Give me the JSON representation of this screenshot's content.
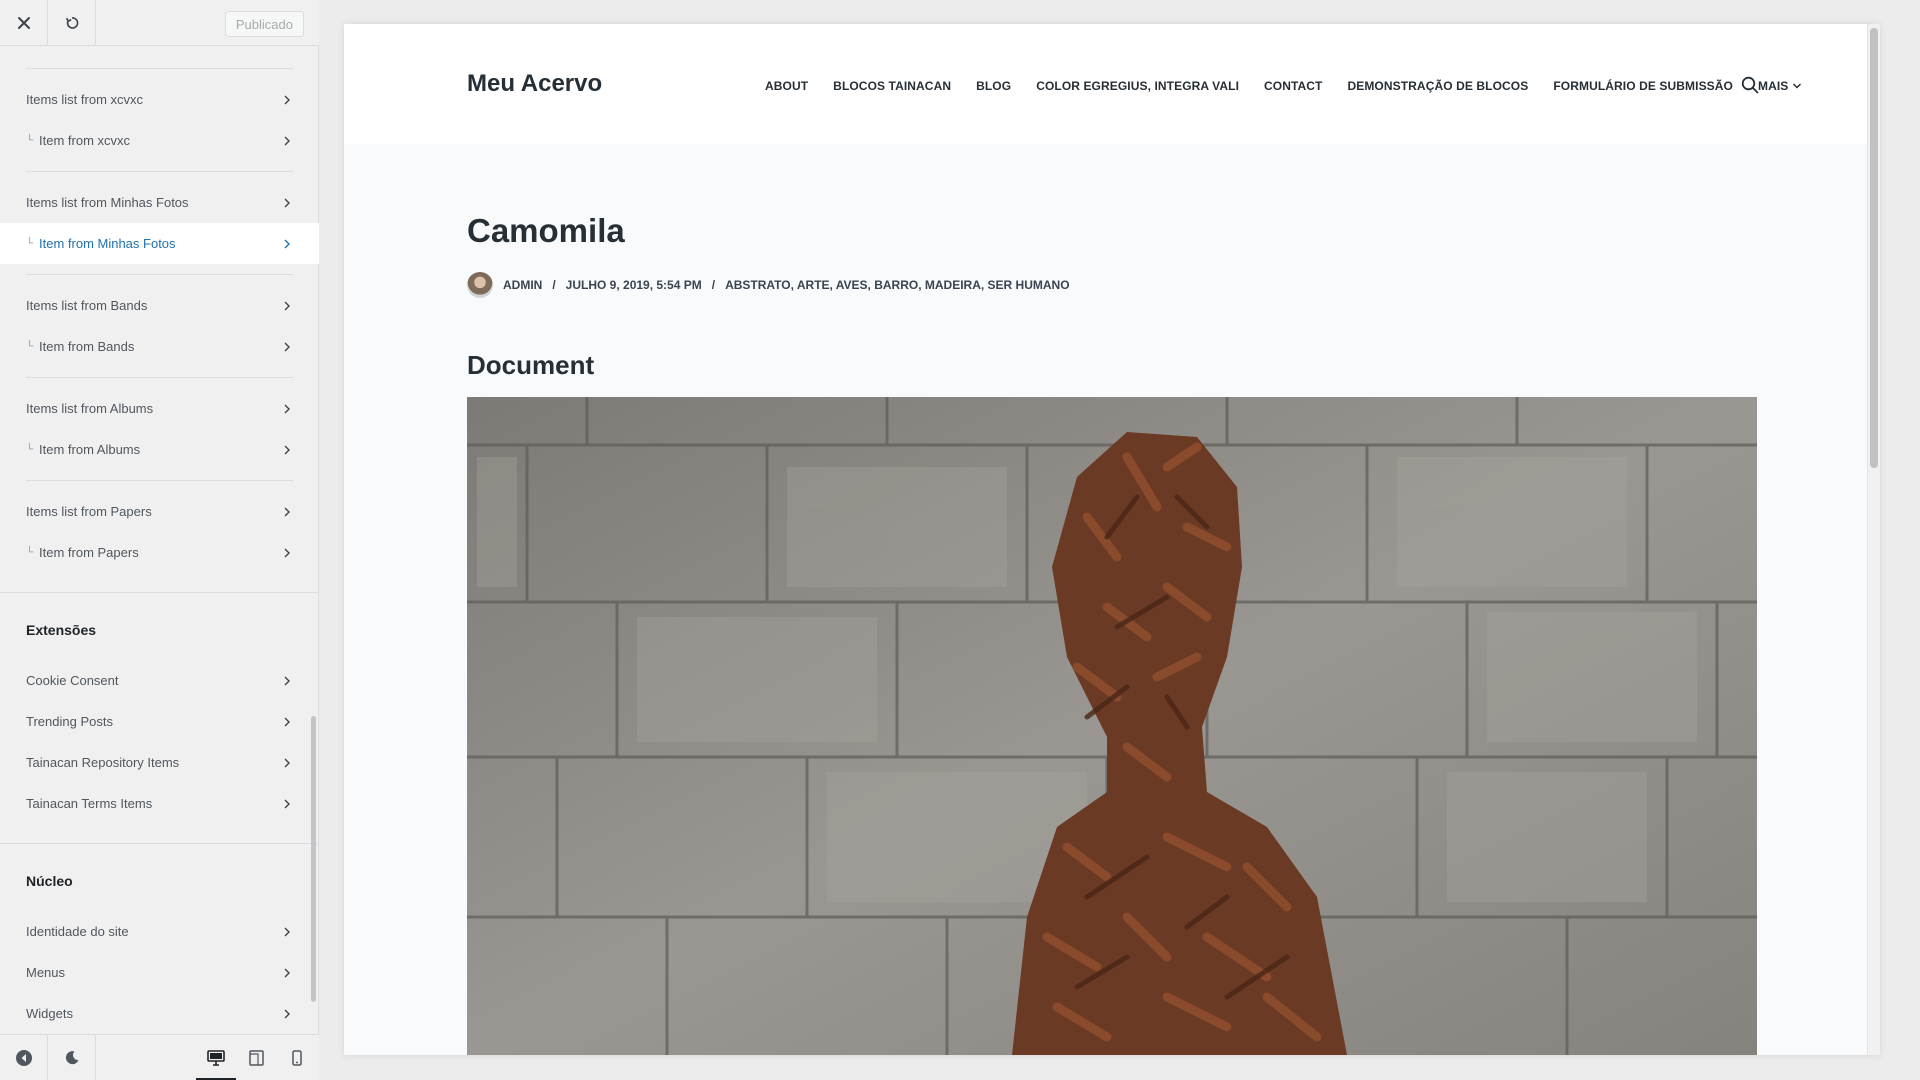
{
  "sidebar": {
    "header": {
      "publish_label": "Publicado"
    },
    "items": [
      {
        "label": "Items list from xcvxc"
      },
      {
        "label": "Item from xcvxc"
      },
      {
        "label": "Items list from Minhas Fotos"
      },
      {
        "label": "Item from Minhas Fotos",
        "active": true
      },
      {
        "label": "Items list from Bands"
      },
      {
        "label": "Item from Bands"
      },
      {
        "label": "Items list from Albums"
      },
      {
        "label": "Item from Albums"
      },
      {
        "label": "Items list from Papers"
      },
      {
        "label": "Item from Papers"
      }
    ],
    "extensions": {
      "title": "Extensões",
      "items": [
        {
          "label": "Cookie Consent"
        },
        {
          "label": "Trending Posts"
        },
        {
          "label": "Tainacan Repository Items"
        },
        {
          "label": "Tainacan Terms Items"
        }
      ]
    },
    "core": {
      "title": "Núcleo",
      "items": [
        {
          "label": "Identidade do site"
        },
        {
          "label": "Menus"
        },
        {
          "label": "Widgets"
        }
      ]
    },
    "footer": {
      "active_device": "desktop"
    }
  },
  "preview": {
    "site_title": "Meu Acervo",
    "nav": [
      "ABOUT",
      "BLOCOS TAINACAN",
      "BLOG",
      "COLOR EGREGIUS, INTEGRA VALI",
      "CONTACT",
      "DEMONSTRAÇÃO DE BLOCOS",
      "FORMULÁRIO DE SUBMISSÃO",
      "MAIS"
    ],
    "post": {
      "title": "Camomila",
      "author": "ADMIN",
      "date": "JULHO 9, 2019, 5:54 PM",
      "categories": "ABSTRATO, ARTE, AVES, BARRO, MADEIRA, SER HUMANO",
      "meta_separator": "/",
      "document_heading": "Document"
    }
  },
  "colors": {
    "accent": "#2271b1",
    "sidebar_bg": "#f0f0f1",
    "heading": "#262f36"
  }
}
